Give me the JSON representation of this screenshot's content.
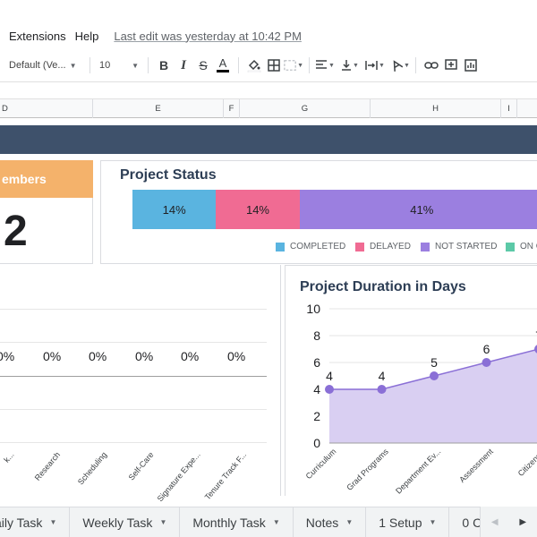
{
  "menu": {
    "items": [
      "Extensions",
      "Help"
    ],
    "last_edit": "Last edit was yesterday at 10:42 PM"
  },
  "toolbar": {
    "font": "Default (Ve...",
    "font_size": "10"
  },
  "columns": [
    "D",
    "E",
    "F",
    "G",
    "H",
    "I"
  ],
  "members": {
    "title": "embers",
    "count": "2"
  },
  "status": {
    "title": "Project Status",
    "segments": [
      {
        "label": "14%",
        "value": 14,
        "color": "#5ab4e0"
      },
      {
        "label": "14%",
        "value": 14,
        "color": "#f06b93"
      },
      {
        "label": "41%",
        "value": 41,
        "color": "#9b7fe0"
      }
    ],
    "legend": [
      {
        "label": "COMPLETED",
        "color": "#5ab4e0"
      },
      {
        "label": "DELAYED",
        "color": "#f06b93"
      },
      {
        "label": "NOT STARTED",
        "color": "#9b7fe0"
      },
      {
        "label": "ON G",
        "color": "#5cc9a7"
      }
    ]
  },
  "tasks": {
    "values": [
      "0%",
      "0%",
      "0%",
      "0%",
      "0%",
      "0%"
    ],
    "categories": [
      "k...",
      "Research",
      "Scheduling",
      "Self-Care",
      "Signature Expe...",
      "Tenure Track F..."
    ]
  },
  "duration": {
    "title": "Project Duration in Days"
  },
  "chart_data": {
    "type": "area",
    "title": "Project Duration in Days",
    "categories": [
      "Curriculum",
      "Grad Programs",
      "Department Ev...",
      "Assessment",
      "Citizenshi"
    ],
    "values": [
      4,
      4,
      5,
      6,
      7
    ],
    "data_labels": [
      "4",
      "4",
      "5",
      "6",
      "7"
    ],
    "yticks": [
      "0",
      "2",
      "4",
      "6",
      "8",
      "10"
    ],
    "ylim": [
      0,
      10
    ],
    "line_color": "#8a6fd6",
    "fill_color": "#d9cff2"
  },
  "sheet_tabs": [
    "aily Task",
    "Weekly Task",
    "Monthly Task",
    "Notes",
    "1 Setup",
    "0 C"
  ]
}
